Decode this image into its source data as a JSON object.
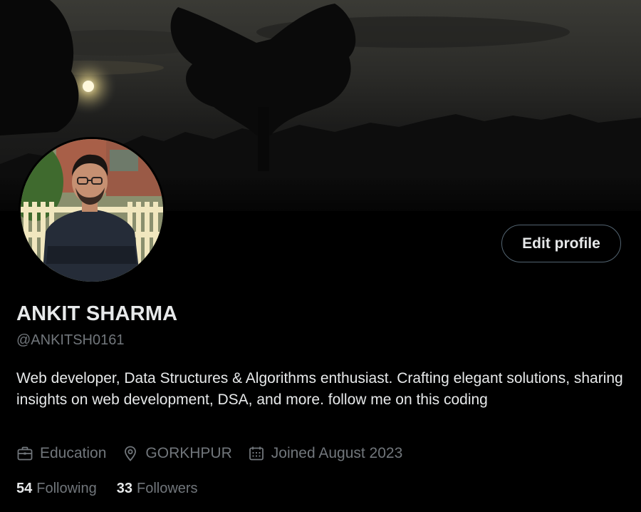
{
  "profile": {
    "display_name": "ANKIT SHARMA",
    "handle": "@ANKITSH0161",
    "bio": "Web developer, Data Structures & Algorithms enthusiast. Crafting elegant solutions, sharing insights on web development, DSA, and more. follow me on this coding",
    "edit_label": "Edit profile",
    "category": "Education",
    "location": "GORKHPUR",
    "joined": "Joined August 2023"
  },
  "stats": {
    "following_count": "54",
    "following_label": "Following",
    "followers_count": "33",
    "followers_label": "Followers"
  },
  "icons": {
    "category": "briefcase-icon",
    "location": "location-pin-icon",
    "joined": "calendar-icon"
  },
  "colors": {
    "background": "#000000",
    "primary_text": "#e7e9ea",
    "secondary_text": "#71767b",
    "button_border": "#536471"
  }
}
